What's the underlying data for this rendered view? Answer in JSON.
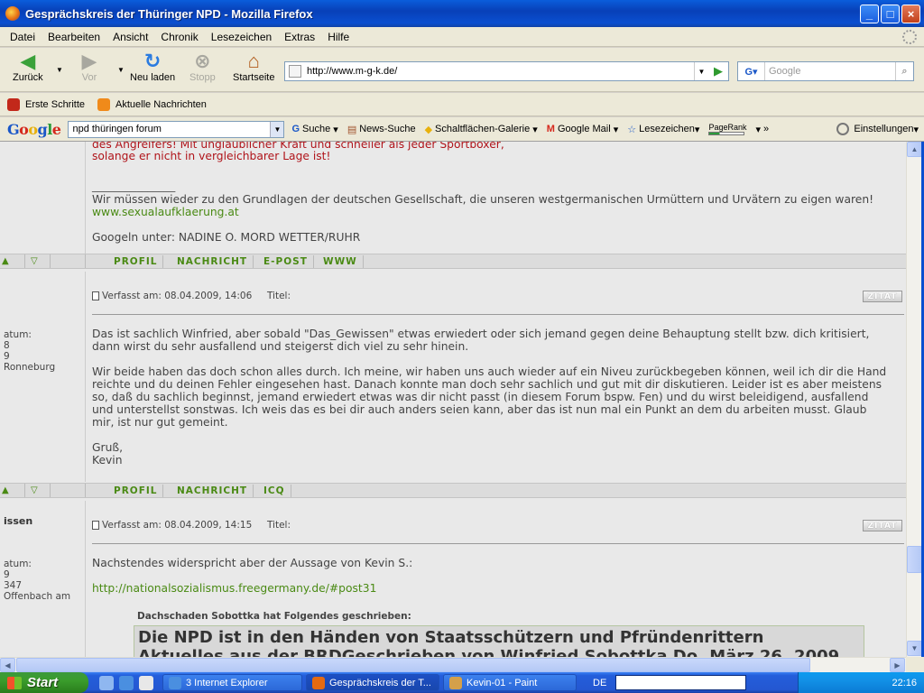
{
  "window": {
    "title": "Gesprächskreis der Thüringer NPD - Mozilla Firefox",
    "controls": [
      "_",
      "□",
      "×"
    ]
  },
  "menu": [
    "Datei",
    "Bearbeiten",
    "Ansicht",
    "Chronik",
    "Lesezeichen",
    "Extras",
    "Hilfe"
  ],
  "nav": {
    "back": "Zurück",
    "forward": "Vor",
    "reload": "Neu laden",
    "stop": "Stopp",
    "home": "Startseite",
    "url": "http://www.m-g-k.de/",
    "search_placeholder": "Google"
  },
  "bookmarks": [
    "Erste Schritte",
    "Aktuelle Nachrichten"
  ],
  "google_toolbar": {
    "query": "npd thüringen forum",
    "search": "Suche",
    "news": "News-Suche",
    "gallery": "Schaltflächen-Galerie",
    "mail": "Google Mail",
    "bookmarks": "Lesezeichen",
    "pagerank": "PageRank",
    "more": "»",
    "settings": "Einstellungen"
  },
  "post1": {
    "red_line1": "des Angreifers! Mit unglaublicher Kraft und schneller als jeder Sportboxer,",
    "red_line2": "solange er nicht in vergleichbarer Lage ist!",
    "sig_rule": "_______________",
    "sig_line": "Wir müssen wieder zu den Grundlagen der deutschen Gesellschaft, die unseren westgermanischen Urmüttern und Urvätern zu eigen waren!",
    "sig_link": "www.sexualaufklaerung.at",
    "sig_google": "Googeln unter: NADINE O. MORD WETTER/RUHR",
    "actions": [
      "PROFIL",
      "NACHRICHT",
      "E-POST",
      "WWW"
    ]
  },
  "post2": {
    "meta": "Verfasst am: 08.04.2009, 14:06",
    "title_label": "Titel:",
    "zitat": "ZITAT",
    "sidebar": [
      "atum:",
      "8",
      "9",
      "Ronneburg"
    ],
    "para1": [
      "Das ist sachlich Winfried, aber sobald \"Das_Gewissen\" etwas erwiedert oder sich jemand gegen deine Behauptung stellt bzw. dich kritisiert,",
      "dann wirst du sehr ausfallend und steigerst dich viel zu sehr hinein."
    ],
    "para2": [
      "Wir beide haben das doch schon alles durch. Ich meine, wir haben uns auch wieder auf ein Niveu zurückbegeben können, weil ich dir die Hand",
      "reichte und du deinen Fehler eingesehen hast. Danach konnte man doch sehr sachlich und gut mit dir diskutieren. Leider ist es aber meistens",
      "so, daß du sachlich beginnst, jemand erwiedert etwas was dir nicht passt (in diesem Forum bspw. Fen) und du wirst beleidigend, ausfallend",
      "und unterstellst sonstwas. Ich weis das es bei dir auch anders seien kann, aber das ist nun mal ein Punkt an dem du arbeiten musst. Glaub",
      "mir, ist nur gut gemeint."
    ],
    "greeting": "Gruß,",
    "signature": "Kevin",
    "actions": [
      "PROFIL",
      "NACHRICHT",
      "ICQ"
    ]
  },
  "post3": {
    "author_partial": "issen",
    "meta": "Verfasst am: 08.04.2009, 14:15",
    "title_label": "Titel:",
    "zitat": "ZITAT",
    "sidebar": [
      "atum:",
      "9",
      "347",
      "Offenbach am"
    ],
    "intro": "Nachstendes widerspricht aber der Aussage von Kevin S.:",
    "link": "http://nationalsozialismus.freegermany.de/#post31",
    "quote_head": "Dachschaden Sobottka hat Folgendes geschrieben:",
    "quote_line1": "Die NPD ist in den Händen von Staatsschützern und Pfründenrittern",
    "quote_line2": "Aktuelles aus der BRDGeschrieben von Winfried Sobottka Do, März 26, 2009"
  },
  "taskbar": {
    "start": "Start",
    "tasks": [
      "3 Internet Explorer",
      "Gesprächskreis der T...",
      "Kevin-01 - Paint"
    ],
    "lang": "DE",
    "clock": "22:16"
  },
  "colors": {
    "title_blue": "#0a4fd0",
    "link_green": "#4a8a14",
    "quote_red": "#b0141a",
    "content_bg": "#e9e9e9"
  }
}
